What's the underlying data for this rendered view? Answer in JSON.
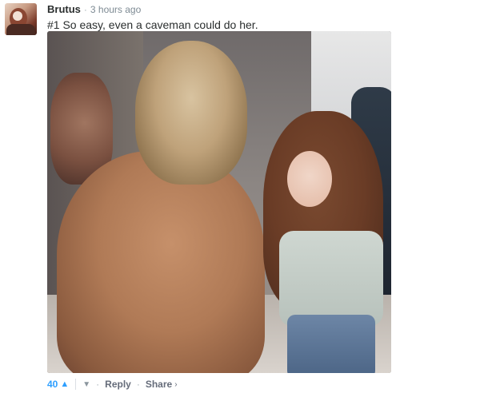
{
  "comment": {
    "author": "Brutus",
    "time": "3 hours ago",
    "separator": "·",
    "message": "#1 So easy, even a caveman could do her."
  },
  "footer": {
    "upvote_count": "40",
    "upvote_icon": "chevron-up-icon",
    "downvote_icon": "chevron-down-icon",
    "reply_label": "Reply",
    "share_label": "Share",
    "share_icon": "chevron-right-icon"
  },
  "colors": {
    "accent": "#2e9fff",
    "text": "#2a2e2e",
    "muted": "#7d8a93"
  }
}
